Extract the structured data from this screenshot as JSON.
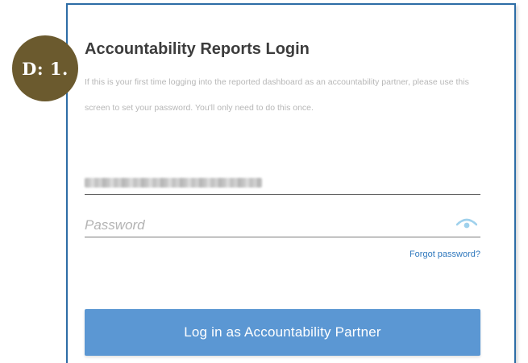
{
  "badge": {
    "label": "D: 1."
  },
  "login": {
    "title": "Accountability Reports Login",
    "intro": "If this is your first time logging into the reported dashboard as an accountability partner, please use this screen to set your password. You'll only need to do this once.",
    "email_value": "",
    "password_placeholder": "Password",
    "forgot_label": "Forgot password?",
    "submit_label": "Log in as Accountability Partner"
  },
  "colors": {
    "card_border": "#2d6da6",
    "badge": "#6b5a2e",
    "button": "#5b97d3",
    "link": "#2f78bd",
    "eye_icon": "#9fd1ec"
  },
  "icons": {
    "password_toggle": "eye-icon"
  }
}
